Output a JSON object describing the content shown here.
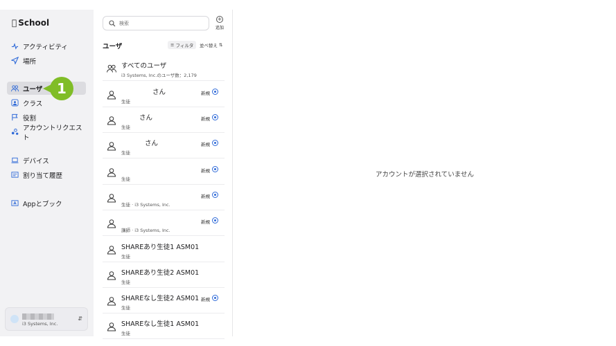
{
  "sidebar": {
    "brand": "School",
    "items": [
      {
        "label": "アクティビティ",
        "icon": "activity-icon"
      },
      {
        "label": "場所",
        "icon": "location-arrow-icon"
      },
      {
        "label": "ユーザ",
        "icon": "users-icon",
        "active": true
      },
      {
        "label": "クラス",
        "icon": "class-icon"
      },
      {
        "label": "役割",
        "icon": "flag-icon"
      },
      {
        "label": "アカウントリクエスト",
        "icon": "account-request-icon"
      },
      {
        "label": "デバイス",
        "icon": "laptop-icon"
      },
      {
        "label": "割り当て履歴",
        "icon": "history-icon"
      },
      {
        "label": "Appとブック",
        "icon": "apps-books-icon"
      }
    ],
    "account": {
      "org": "i3 Systems, Inc."
    }
  },
  "callout": {
    "number": "1",
    "color": "#80bd27"
  },
  "list": {
    "search_placeholder": "検索",
    "add_label": "追加",
    "header": "ユーザ",
    "filter_label": "フィルタ",
    "sort_label": "並べ替え",
    "rows": [
      {
        "name": "すべてのユーザ",
        "sub": "i3 Systems, Inc.のユーザ数：2,179",
        "badge": "",
        "icon": "users-icon"
      },
      {
        "name": "さん",
        "sub": "生徒",
        "badge": "新規",
        "icon": "user-icon"
      },
      {
        "name": "さん",
        "sub": "生徒",
        "badge": "新規",
        "icon": "user-icon"
      },
      {
        "name": "さん",
        "sub": "生徒",
        "badge": "新規",
        "icon": "user-icon"
      },
      {
        "name": "",
        "sub": "生徒",
        "badge": "新規",
        "icon": "user-icon"
      },
      {
        "name": "",
        "sub": "生徒 · i3 Systems, Inc.",
        "badge": "新規",
        "icon": "user-icon"
      },
      {
        "name": "",
        "sub": "講師 · i3 Systems, Inc.",
        "badge": "新規",
        "icon": "user-icon"
      },
      {
        "name": "SHAREあり生徒1 ASM01",
        "sub": "生徒",
        "badge": "",
        "icon": "user-icon"
      },
      {
        "name": "SHAREあり生徒2 ASM01",
        "sub": "生徒",
        "badge": "",
        "icon": "user-icon"
      },
      {
        "name": "SHAREなし生徒2 ASM01",
        "sub": "生徒",
        "badge": "新規",
        "icon": "user-icon"
      },
      {
        "name": "SHAREなし生徒1 ASM01",
        "sub": "生徒",
        "badge": "",
        "icon": "user-icon"
      }
    ]
  },
  "detail": {
    "empty_message": "アカウントが選択されていません"
  },
  "colors": {
    "accent": "#2f6ad8",
    "callout": "#80bd27",
    "sidebar_bg": "#f2f2f4"
  }
}
